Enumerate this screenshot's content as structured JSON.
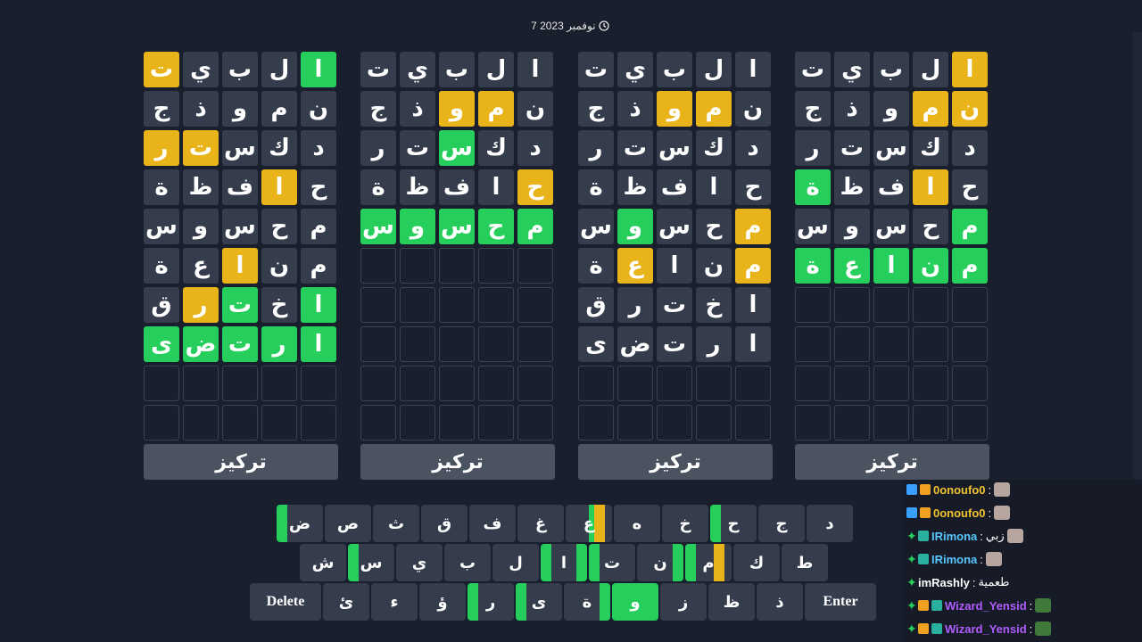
{
  "date": "7 نوفمبر 2023",
  "focus_label": "تركيز",
  "boards": [
    {
      "rows": [
        [
          [
            "ت",
            "y"
          ],
          [
            "ي",
            "n"
          ],
          [
            "ب",
            "n"
          ],
          [
            "ل",
            "n"
          ],
          [
            "ا",
            "g"
          ]
        ],
        [
          [
            "ج",
            "n"
          ],
          [
            "ذ",
            "n"
          ],
          [
            "و",
            "n"
          ],
          [
            "م",
            "n"
          ],
          [
            "ن",
            "n"
          ]
        ],
        [
          [
            "ر",
            "y"
          ],
          [
            "ت",
            "y"
          ],
          [
            "س",
            "n"
          ],
          [
            "ك",
            "n"
          ],
          [
            "د",
            "n"
          ]
        ],
        [
          [
            "ة",
            "n"
          ],
          [
            "ظ",
            "n"
          ],
          [
            "ف",
            "n"
          ],
          [
            "ا",
            "y"
          ],
          [
            "ح",
            "n"
          ]
        ],
        [
          [
            "س",
            "n"
          ],
          [
            "و",
            "n"
          ],
          [
            "س",
            "n"
          ],
          [
            "ح",
            "n"
          ],
          [
            "م",
            "n"
          ]
        ],
        [
          [
            "ة",
            "n"
          ],
          [
            "ع",
            "n"
          ],
          [
            "ا",
            "y"
          ],
          [
            "ن",
            "n"
          ],
          [
            "م",
            "n"
          ]
        ],
        [
          [
            "ق",
            "n"
          ],
          [
            "ر",
            "y"
          ],
          [
            "ت",
            "g"
          ],
          [
            "خ",
            "n"
          ],
          [
            "ا",
            "g"
          ]
        ],
        [
          [
            "ى",
            "g"
          ],
          [
            "ض",
            "g"
          ],
          [
            "ت",
            "g"
          ],
          [
            "ر",
            "g"
          ],
          [
            "ا",
            "g"
          ]
        ],
        [
          [
            "",
            "e"
          ],
          [
            "",
            "e"
          ],
          [
            "",
            "e"
          ],
          [
            "",
            "e"
          ],
          [
            "",
            "e"
          ]
        ],
        [
          [
            "",
            "e"
          ],
          [
            "",
            "e"
          ],
          [
            "",
            "e"
          ],
          [
            "",
            "e"
          ],
          [
            "",
            "e"
          ]
        ]
      ]
    },
    {
      "rows": [
        [
          [
            "ت",
            "n"
          ],
          [
            "ي",
            "n"
          ],
          [
            "ب",
            "n"
          ],
          [
            "ل",
            "n"
          ],
          [
            "ا",
            "n"
          ]
        ],
        [
          [
            "ج",
            "n"
          ],
          [
            "ذ",
            "n"
          ],
          [
            "و",
            "y"
          ],
          [
            "م",
            "y"
          ],
          [
            "ن",
            "n"
          ]
        ],
        [
          [
            "ر",
            "n"
          ],
          [
            "ت",
            "n"
          ],
          [
            "س",
            "g"
          ],
          [
            "ك",
            "n"
          ],
          [
            "د",
            "n"
          ]
        ],
        [
          [
            "ة",
            "n"
          ],
          [
            "ظ",
            "n"
          ],
          [
            "ف",
            "n"
          ],
          [
            "ا",
            "n"
          ],
          [
            "ح",
            "y"
          ]
        ],
        [
          [
            "س",
            "g"
          ],
          [
            "و",
            "g"
          ],
          [
            "س",
            "g"
          ],
          [
            "ح",
            "g"
          ],
          [
            "م",
            "g"
          ]
        ],
        [
          [
            "",
            "e"
          ],
          [
            "",
            "e"
          ],
          [
            "",
            "e"
          ],
          [
            "",
            "e"
          ],
          [
            "",
            "e"
          ]
        ],
        [
          [
            "",
            "e"
          ],
          [
            "",
            "e"
          ],
          [
            "",
            "e"
          ],
          [
            "",
            "e"
          ],
          [
            "",
            "e"
          ]
        ],
        [
          [
            "",
            "e"
          ],
          [
            "",
            "e"
          ],
          [
            "",
            "e"
          ],
          [
            "",
            "e"
          ],
          [
            "",
            "e"
          ]
        ],
        [
          [
            "",
            "e"
          ],
          [
            "",
            "e"
          ],
          [
            "",
            "e"
          ],
          [
            "",
            "e"
          ],
          [
            "",
            "e"
          ]
        ],
        [
          [
            "",
            "e"
          ],
          [
            "",
            "e"
          ],
          [
            "",
            "e"
          ],
          [
            "",
            "e"
          ],
          [
            "",
            "e"
          ]
        ]
      ]
    },
    {
      "rows": [
        [
          [
            "ت",
            "n"
          ],
          [
            "ي",
            "n"
          ],
          [
            "ب",
            "n"
          ],
          [
            "ل",
            "n"
          ],
          [
            "ا",
            "n"
          ]
        ],
        [
          [
            "ج",
            "n"
          ],
          [
            "ذ",
            "n"
          ],
          [
            "و",
            "y"
          ],
          [
            "م",
            "y"
          ],
          [
            "ن",
            "n"
          ]
        ],
        [
          [
            "ر",
            "n"
          ],
          [
            "ت",
            "n"
          ],
          [
            "س",
            "n"
          ],
          [
            "ك",
            "n"
          ],
          [
            "د",
            "n"
          ]
        ],
        [
          [
            "ة",
            "n"
          ],
          [
            "ظ",
            "n"
          ],
          [
            "ف",
            "n"
          ],
          [
            "ا",
            "n"
          ],
          [
            "ح",
            "n"
          ]
        ],
        [
          [
            "س",
            "n"
          ],
          [
            "و",
            "g"
          ],
          [
            "س",
            "n"
          ],
          [
            "ح",
            "n"
          ],
          [
            "م",
            "y"
          ]
        ],
        [
          [
            "ة",
            "n"
          ],
          [
            "ع",
            "y"
          ],
          [
            "ا",
            "n"
          ],
          [
            "ن",
            "n"
          ],
          [
            "م",
            "y"
          ]
        ],
        [
          [
            "ق",
            "n"
          ],
          [
            "ر",
            "n"
          ],
          [
            "ت",
            "n"
          ],
          [
            "خ",
            "n"
          ],
          [
            "ا",
            "n"
          ]
        ],
        [
          [
            "ى",
            "n"
          ],
          [
            "ض",
            "n"
          ],
          [
            "ت",
            "n"
          ],
          [
            "ر",
            "n"
          ],
          [
            "ا",
            "n"
          ]
        ],
        [
          [
            "",
            "e"
          ],
          [
            "",
            "e"
          ],
          [
            "",
            "e"
          ],
          [
            "",
            "e"
          ],
          [
            "",
            "e"
          ]
        ],
        [
          [
            "",
            "e"
          ],
          [
            "",
            "e"
          ],
          [
            "",
            "e"
          ],
          [
            "",
            "e"
          ],
          [
            "",
            "e"
          ]
        ]
      ]
    },
    {
      "rows": [
        [
          [
            "ت",
            "n"
          ],
          [
            "ي",
            "n"
          ],
          [
            "ب",
            "n"
          ],
          [
            "ل",
            "n"
          ],
          [
            "ا",
            "y"
          ]
        ],
        [
          [
            "ج",
            "n"
          ],
          [
            "ذ",
            "n"
          ],
          [
            "و",
            "n"
          ],
          [
            "م",
            "y"
          ],
          [
            "ن",
            "y"
          ]
        ],
        [
          [
            "ر",
            "n"
          ],
          [
            "ت",
            "n"
          ],
          [
            "س",
            "n"
          ],
          [
            "ك",
            "n"
          ],
          [
            "د",
            "n"
          ]
        ],
        [
          [
            "ة",
            "g"
          ],
          [
            "ظ",
            "n"
          ],
          [
            "ف",
            "n"
          ],
          [
            "ا",
            "y"
          ],
          [
            "ح",
            "n"
          ]
        ],
        [
          [
            "س",
            "n"
          ],
          [
            "و",
            "n"
          ],
          [
            "س",
            "n"
          ],
          [
            "ح",
            "n"
          ],
          [
            "م",
            "g"
          ]
        ],
        [
          [
            "ة",
            "g"
          ],
          [
            "ع",
            "g"
          ],
          [
            "ا",
            "g"
          ],
          [
            "ن",
            "g"
          ],
          [
            "م",
            "g"
          ]
        ],
        [
          [
            "",
            "e"
          ],
          [
            "",
            "e"
          ],
          [
            "",
            "e"
          ],
          [
            "",
            "e"
          ],
          [
            "",
            "e"
          ]
        ],
        [
          [
            "",
            "e"
          ],
          [
            "",
            "e"
          ],
          [
            "",
            "e"
          ],
          [
            "",
            "e"
          ],
          [
            "",
            "e"
          ]
        ],
        [
          [
            "",
            "e"
          ],
          [
            "",
            "e"
          ],
          [
            "",
            "e"
          ],
          [
            "",
            "e"
          ],
          [
            "",
            "e"
          ]
        ],
        [
          [
            "",
            "e"
          ],
          [
            "",
            "e"
          ],
          [
            "",
            "e"
          ],
          [
            "",
            "e"
          ],
          [
            "",
            "e"
          ]
        ]
      ]
    }
  ],
  "keyboard": {
    "rows": [
      [
        {
          "label": "ض",
          "bars": [
            [
              "g",
              "left"
            ]
          ]
        },
        {
          "label": "ص",
          "bars": []
        },
        {
          "label": "ث",
          "bars": []
        },
        {
          "label": "ق",
          "bars": []
        },
        {
          "label": "ف",
          "bars": []
        },
        {
          "label": "غ",
          "bars": []
        },
        {
          "label": "ع",
          "bars": [
            [
              "g",
              "midL"
            ],
            [
              "y",
              "midR"
            ]
          ]
        },
        {
          "label": "ه",
          "bars": []
        },
        {
          "label": "خ",
          "bars": []
        },
        {
          "label": "ح",
          "bars": [
            [
              "g",
              "left"
            ]
          ]
        },
        {
          "label": "ج",
          "bars": []
        },
        {
          "label": "د",
          "bars": []
        }
      ],
      [
        {
          "label": "ش",
          "bars": []
        },
        {
          "label": "س",
          "bars": [
            [
              "g",
              "left"
            ]
          ]
        },
        {
          "label": "ي",
          "bars": []
        },
        {
          "label": "ب",
          "bars": []
        },
        {
          "label": "ل",
          "bars": []
        },
        {
          "label": "ا",
          "bars": [
            [
              "g",
              "left"
            ],
            [
              "g",
              "right"
            ]
          ]
        },
        {
          "label": "ت",
          "bars": [
            [
              "g",
              "left"
            ]
          ]
        },
        {
          "label": "ن",
          "bars": [
            [
              "g",
              "right"
            ]
          ]
        },
        {
          "label": "م",
          "bars": [
            [
              "g",
              "left"
            ],
            [
              "y",
              "midR"
            ]
          ]
        },
        {
          "label": "ك",
          "bars": []
        },
        {
          "label": "ط",
          "bars": []
        }
      ],
      [
        {
          "label": "Delete",
          "wide": true,
          "bars": []
        },
        {
          "label": "ئ",
          "bars": []
        },
        {
          "label": "ء",
          "bars": []
        },
        {
          "label": "ؤ",
          "bars": []
        },
        {
          "label": "ر",
          "bars": [
            [
              "g",
              "left"
            ]
          ]
        },
        {
          "label": "ى",
          "bars": [
            [
              "g",
              "left"
            ]
          ]
        },
        {
          "label": "ة",
          "bars": [
            [
              "g",
              "right"
            ]
          ]
        },
        {
          "label": "و",
          "bars": [
            [
              "g",
              "full"
            ]
          ]
        },
        {
          "label": "ز",
          "bars": []
        },
        {
          "label": "ظ",
          "bars": []
        },
        {
          "label": "ذ",
          "bars": []
        },
        {
          "label": "Enter",
          "wide": true,
          "bars": []
        }
      ]
    ]
  },
  "colors": {
    "green": "#26cf5c",
    "yellow": "#e9b419",
    "dark": "#353d4d",
    "bg": "#1a1f2e"
  },
  "chat": [
    {
      "user": "0onoufo0",
      "text": "",
      "user_color": "#f2c230",
      "badges": [
        "blue",
        "gold"
      ]
    },
    {
      "user": "0onoufo0",
      "text": "",
      "user_color": "#f2c230",
      "badges": [
        "blue",
        "gold"
      ]
    },
    {
      "user": "IRimona",
      "text": "زبي",
      "user_color": "#58c7ff",
      "badges": [
        "green",
        "teal"
      ]
    },
    {
      "user": "IRimona",
      "text": "",
      "user_color": "#58c7ff",
      "badges": [
        "green",
        "teal"
      ]
    },
    {
      "user": "imRashly",
      "text": "طعمية",
      "user_color": "#ffffff",
      "badges": [
        "green"
      ]
    },
    {
      "user": "Wizard_Yensid",
      "text": "",
      "user_color": "#b05cff",
      "badges": [
        "green",
        "gold",
        "teal"
      ]
    },
    {
      "user": "Wizard_Yensid",
      "text": "",
      "user_color": "#b05cff",
      "badges": [
        "green",
        "gold",
        "teal"
      ]
    }
  ]
}
